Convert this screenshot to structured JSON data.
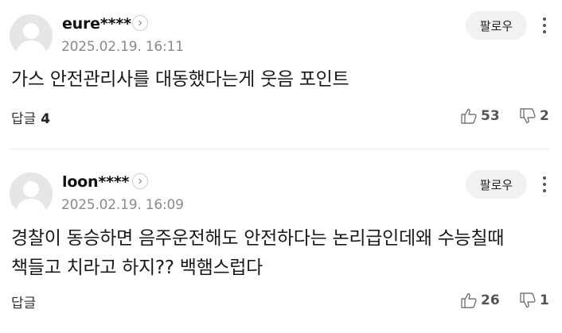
{
  "comments": [
    {
      "username": "eure****",
      "timestamp": "2025.02.19. 16:11",
      "follow_label": "팔로우",
      "body": "가스 안전관리사를 대동했다는게 웃음 포인트",
      "reply_label": "답글",
      "reply_count": "4",
      "likes": "53",
      "dislikes": "2"
    },
    {
      "username": "loon****",
      "timestamp": "2025.02.19. 16:09",
      "follow_label": "팔로우",
      "body": "경찰이 동승하면 음주운전해도 안전하다는 논리급인데왜 수능칠때 책들고 치라고 하지?? 백햄스럽다",
      "reply_label": "답글",
      "reply_count": "",
      "likes": "26",
      "dislikes": "1"
    }
  ],
  "icons": {
    "avatar": "default-avatar-icon",
    "profile_arrow": "chevron-right-icon",
    "more": "more-vertical-icon",
    "like": "thumbs-up-icon",
    "dislike": "thumbs-down-icon"
  }
}
